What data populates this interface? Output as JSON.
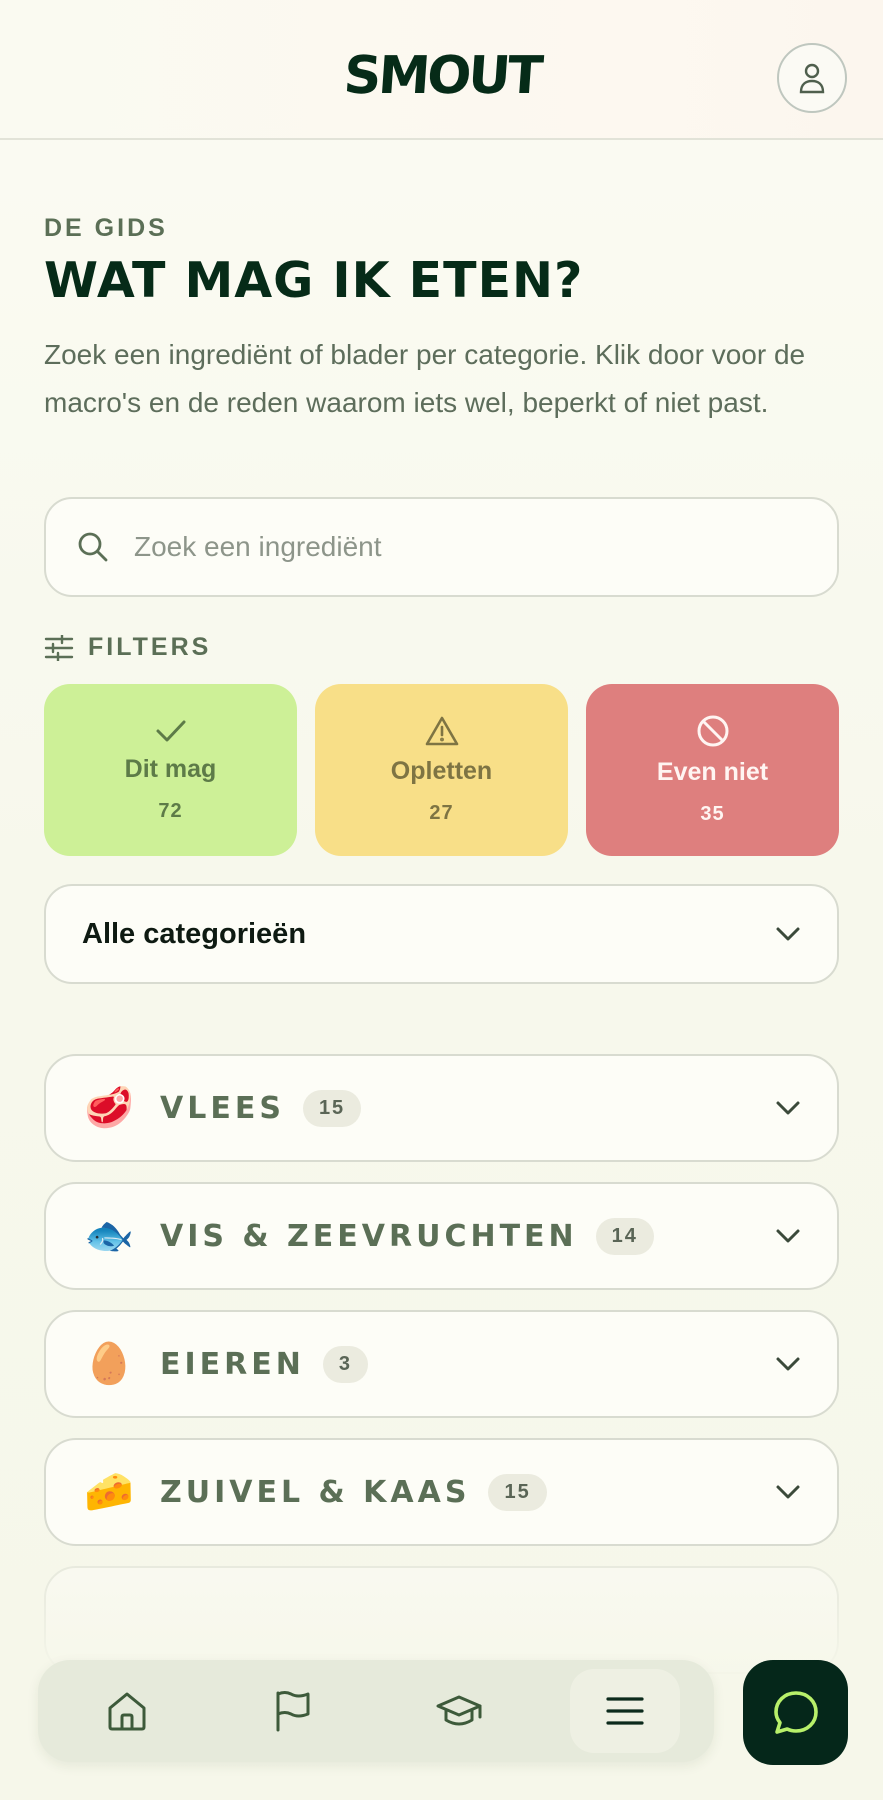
{
  "header": {
    "logo_text": "SMOUT",
    "profile_icon": "user-icon"
  },
  "intro": {
    "eyebrow": "DE GIDS",
    "title": "WAT MAG IK ETEN?",
    "description": "Zoek een ingrediënt of blader per categorie. Klik door voor de macro's en de reden waarom iets wel, beperkt of niet past."
  },
  "search": {
    "placeholder": "Zoek een ingrediënt",
    "value": "",
    "icon": "search-icon"
  },
  "filters": {
    "label": "FILTERS",
    "icon": "sliders-icon",
    "items": [
      {
        "label": "Dit mag",
        "count": "72",
        "icon": "check-icon",
        "color": "#cdf097"
      },
      {
        "label": "Opletten",
        "count": "27",
        "icon": "warning-icon",
        "color": "#f8df88"
      },
      {
        "label": "Even niet",
        "count": "35",
        "icon": "prohibited-icon",
        "color": "#de7f7e"
      }
    ]
  },
  "category_select": {
    "selected": "Alle categorieën"
  },
  "categories": [
    {
      "emoji": "🥩",
      "name": "VLEES",
      "count": "15"
    },
    {
      "emoji": "🐟",
      "name": "VIS & ZEEVRUCHTEN",
      "count": "14"
    },
    {
      "emoji": "🥚",
      "name": "EIEREN",
      "count": "3"
    },
    {
      "emoji": "🧀",
      "name": "ZUIVEL & KAAS",
      "count": "15"
    }
  ],
  "bottom_nav": {
    "items": [
      {
        "icon": "home-icon"
      },
      {
        "icon": "flag-icon"
      },
      {
        "icon": "graduation-cap-icon"
      },
      {
        "icon": "menu-icon",
        "active": true
      }
    ],
    "chat_icon": "chat-bubble-icon"
  }
}
